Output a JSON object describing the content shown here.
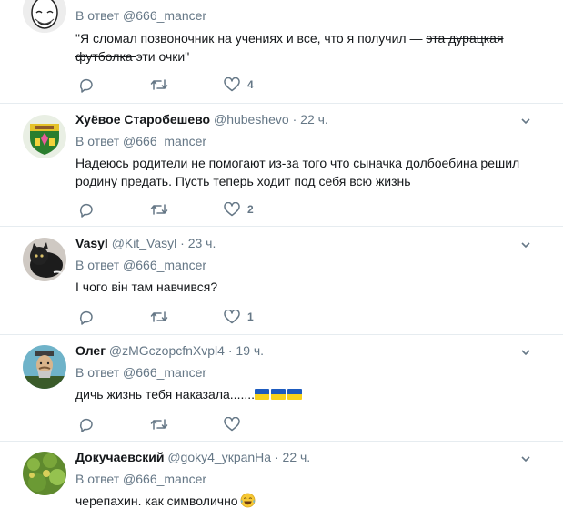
{
  "tweets": [
    {
      "name": "",
      "handle": "",
      "time": "",
      "reply_prefix": "В ответ",
      "reply_to": "@666_mancer",
      "text_a": "\"Я сломал позвоночник на учениях и все, что я получил — ",
      "text_strike": "эта дурацкая футболка ",
      "text_b": "эти очки\"",
      "likes": "4",
      "avatar_icon": "bald-man-cartoon-avatar"
    },
    {
      "name": "Хуёвое Старобешево",
      "handle": "@hubeshevo",
      "dot": "·",
      "time": "22 ч.",
      "reply_prefix": "В ответ",
      "reply_to": "@666_mancer",
      "text": "Надеюсь родители не помогают из-за того что сыначка долбоебина решил родину предать. Пусть теперь ходит под себя всю жизнь",
      "likes": "2",
      "avatar_icon": "coat-of-arms-avatar"
    },
    {
      "name": "Vasyl",
      "handle": "@Kit_Vasyl",
      "dot": "·",
      "time": "23 ч.",
      "reply_prefix": "В ответ",
      "reply_to": "@666_mancer",
      "text": "І чого він там навчився?",
      "likes": "1",
      "avatar_icon": "black-cat-avatar"
    },
    {
      "name": "Олег",
      "handle": "@zMGczopcfnXvpl4",
      "dot": "·",
      "time": "19 ч.",
      "reply_prefix": "В ответ",
      "reply_to": "@666_mancer",
      "text": "дичь жизнь тебя наказала.......",
      "likes": "",
      "avatar_icon": "cossack-avatar"
    },
    {
      "name": "Докучаевский",
      "handle": "@goky4_укрanHa",
      "dot": "·",
      "time": "22 ч.",
      "reply_prefix": "В ответ",
      "reply_to": "@666_mancer",
      "text": "черепахин. как символично",
      "avatar_icon": "green-plant-avatar"
    }
  ],
  "icons": {
    "reply": "reply-icon",
    "retweet": "retweet-icon",
    "like": "heart-icon",
    "menu": "chevron-down-icon",
    "flag": "ukraine-flag-icon",
    "emoji": "tears-of-joy-emoji"
  },
  "colors": {
    "text": "#14171a",
    "secondary": "#657786",
    "divider": "#e6ecf0",
    "flag_blue": "#1d5bbf",
    "flag_yellow": "#f7d21c"
  }
}
